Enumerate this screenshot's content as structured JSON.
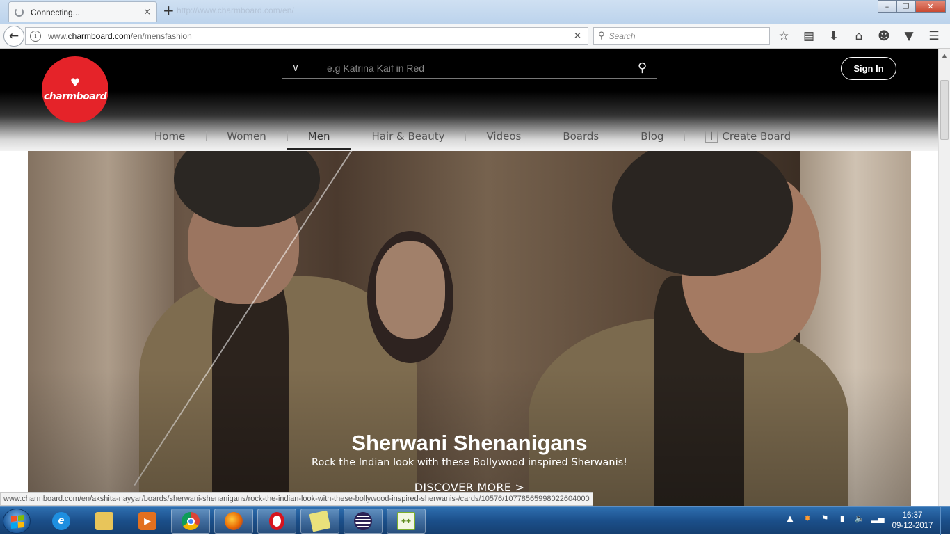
{
  "browser": {
    "tab_title": "Connecting...",
    "tab_close": "×",
    "new_tab": "+",
    "background_tab_hint": "http://www.charmboard.com/en/",
    "url_prefix": "www.",
    "url_domain": "charmboard.com",
    "url_path": "/en/mensfashion",
    "url_stop": "✕",
    "search_placeholder": "Search",
    "window_buttons": {
      "minimize": "–",
      "maximize": "❐",
      "close": "✕"
    },
    "toolbar_icons": [
      "bookmark-star-icon",
      "reading-list-icon",
      "downloads-icon",
      "home-icon",
      "hello-icon",
      "pocket-icon"
    ],
    "menu_icon": "☰"
  },
  "site": {
    "logo_text": "charmboard",
    "search_placeholder": "e.g Katrina Kaif in Red",
    "signin_label": "Sign In",
    "nav": [
      {
        "label": "Home"
      },
      {
        "label": "Women"
      },
      {
        "label": "Men",
        "active": true
      },
      {
        "label": "Hair & Beauty"
      },
      {
        "label": "Videos"
      },
      {
        "label": "Boards"
      },
      {
        "label": "Blog"
      },
      {
        "label": "Create Board"
      }
    ],
    "accent_color": "#e52329"
  },
  "hero": {
    "title": "Sherwani Shenanigans",
    "subtitle": "Rock the Indian look with these Bollywood inspired Sherwanis!",
    "cta": "DISCOVER MORE >"
  },
  "status_url": "www.charmboard.com/en/akshita-nayyar/boards/sherwani-shenanigans/rock-the-indian-look-with-these-bollywood-inspired-sherwanis-/cards/10576/10778565998022604000",
  "taskbar": {
    "apps": [
      "internet-explorer",
      "file-explorer",
      "media-player",
      "chrome",
      "firefox",
      "opera",
      "sticky-notes",
      "eclipse",
      "notepad-plus"
    ],
    "time": "16:37",
    "date": "09-12-2017"
  }
}
